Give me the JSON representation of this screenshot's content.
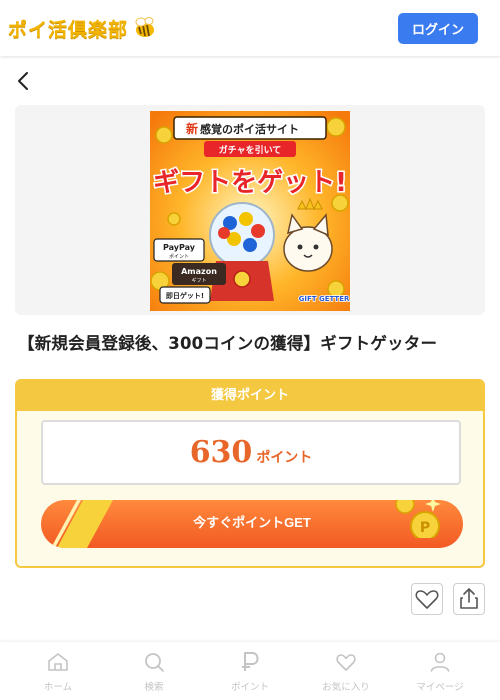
{
  "header": {
    "logo_text": "ポイ活倶楽部",
    "login_label": "ログイン"
  },
  "banner": {
    "line1_accent": "新",
    "line1": "感覚のポイ活サイト",
    "line2": "ガチャを引いて",
    "line3": "ギフトをゲット!",
    "tags": [
      "PayPay",
      "ポイント",
      "Amazon",
      "ギフト",
      "即日ゲット!"
    ],
    "brand": "GIFT GETTER"
  },
  "offer_title": "【新規会員登録後、300コインの獲得】ギフトゲッター",
  "points_card": {
    "heading": "獲得ポイント",
    "value": "630",
    "unit": "ポイント",
    "button_label": "今すぐポイントGET"
  },
  "bottom_nav": [
    {
      "label": "ホーム",
      "icon": "home-icon"
    },
    {
      "label": "検索",
      "icon": "search-icon"
    },
    {
      "label": "ポイント",
      "icon": "point-icon"
    },
    {
      "label": "お気に入り",
      "icon": "heart-icon"
    },
    {
      "label": "マイページ",
      "icon": "user-icon"
    }
  ],
  "colors": {
    "accent_blue": "#3b7bf0",
    "card_yellow": "#f5c842",
    "point_orange": "#e8662a",
    "nav_gray": "#c4c4c4"
  }
}
